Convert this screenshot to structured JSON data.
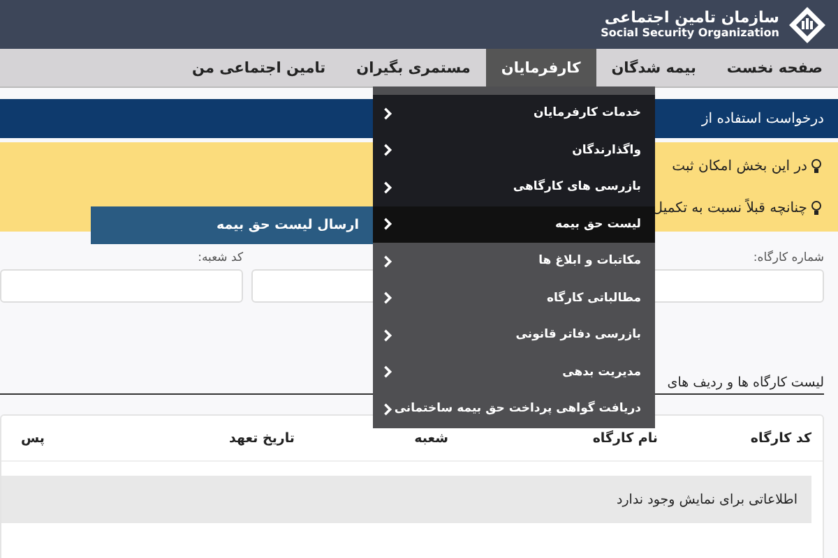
{
  "header": {
    "logo_title": "سازمان تامین اجتماعی",
    "logo_subtitle": "Social Security Organization"
  },
  "nav": [
    {
      "label": "صفحه نخست",
      "selected": false
    },
    {
      "label": "بیمه شدگان",
      "selected": false
    },
    {
      "label": "کارفرمایان",
      "selected": true
    },
    {
      "label": "مستمری بگیران",
      "selected": false
    },
    {
      "label": "تامین اجتماعی من",
      "selected": false
    }
  ],
  "banner": {
    "title": "درخواست استفاده از"
  },
  "notices": [
    "در این بخش امکان ثبت",
    "چنانچه قبلاً نسبت به تکمیل"
  ],
  "form": {
    "fields": [
      {
        "label": "شماره کارگاه:"
      },
      {
        "label": "کد شعبه:"
      }
    ]
  },
  "list_title": "لیست کارگاه ها و ردیف های",
  "table": {
    "columns": [
      "کد کارگاه",
      "نام کارگاه",
      "شعبه",
      "تاریخ تعهد",
      "پس"
    ],
    "empty_message": "اطلاعاتی برای نمایش وجود ندارد"
  },
  "menu": {
    "items": [
      {
        "label": "خدمات کارفرمایان",
        "selected": false
      },
      {
        "label": "واگذارندگان",
        "selected": false
      },
      {
        "label": "بازرسی های کارگاهی",
        "selected": false
      },
      {
        "label": "لیست حق بیمه",
        "selected": true
      },
      {
        "label": "مکاتبات و ابلاغ ها",
        "selected": false
      },
      {
        "label": "مطالباتی کارگاه",
        "selected": false
      },
      {
        "label": "بازرسی دفاتر قانونی",
        "selected": false
      },
      {
        "label": "مدیریت بدهی",
        "selected": false
      },
      {
        "label": "دریافت گواهی پرداخت حق بیمه ساختمانی",
        "selected": false
      }
    ],
    "submenu": [
      "ارسال لیست حق بیمه"
    ]
  }
}
